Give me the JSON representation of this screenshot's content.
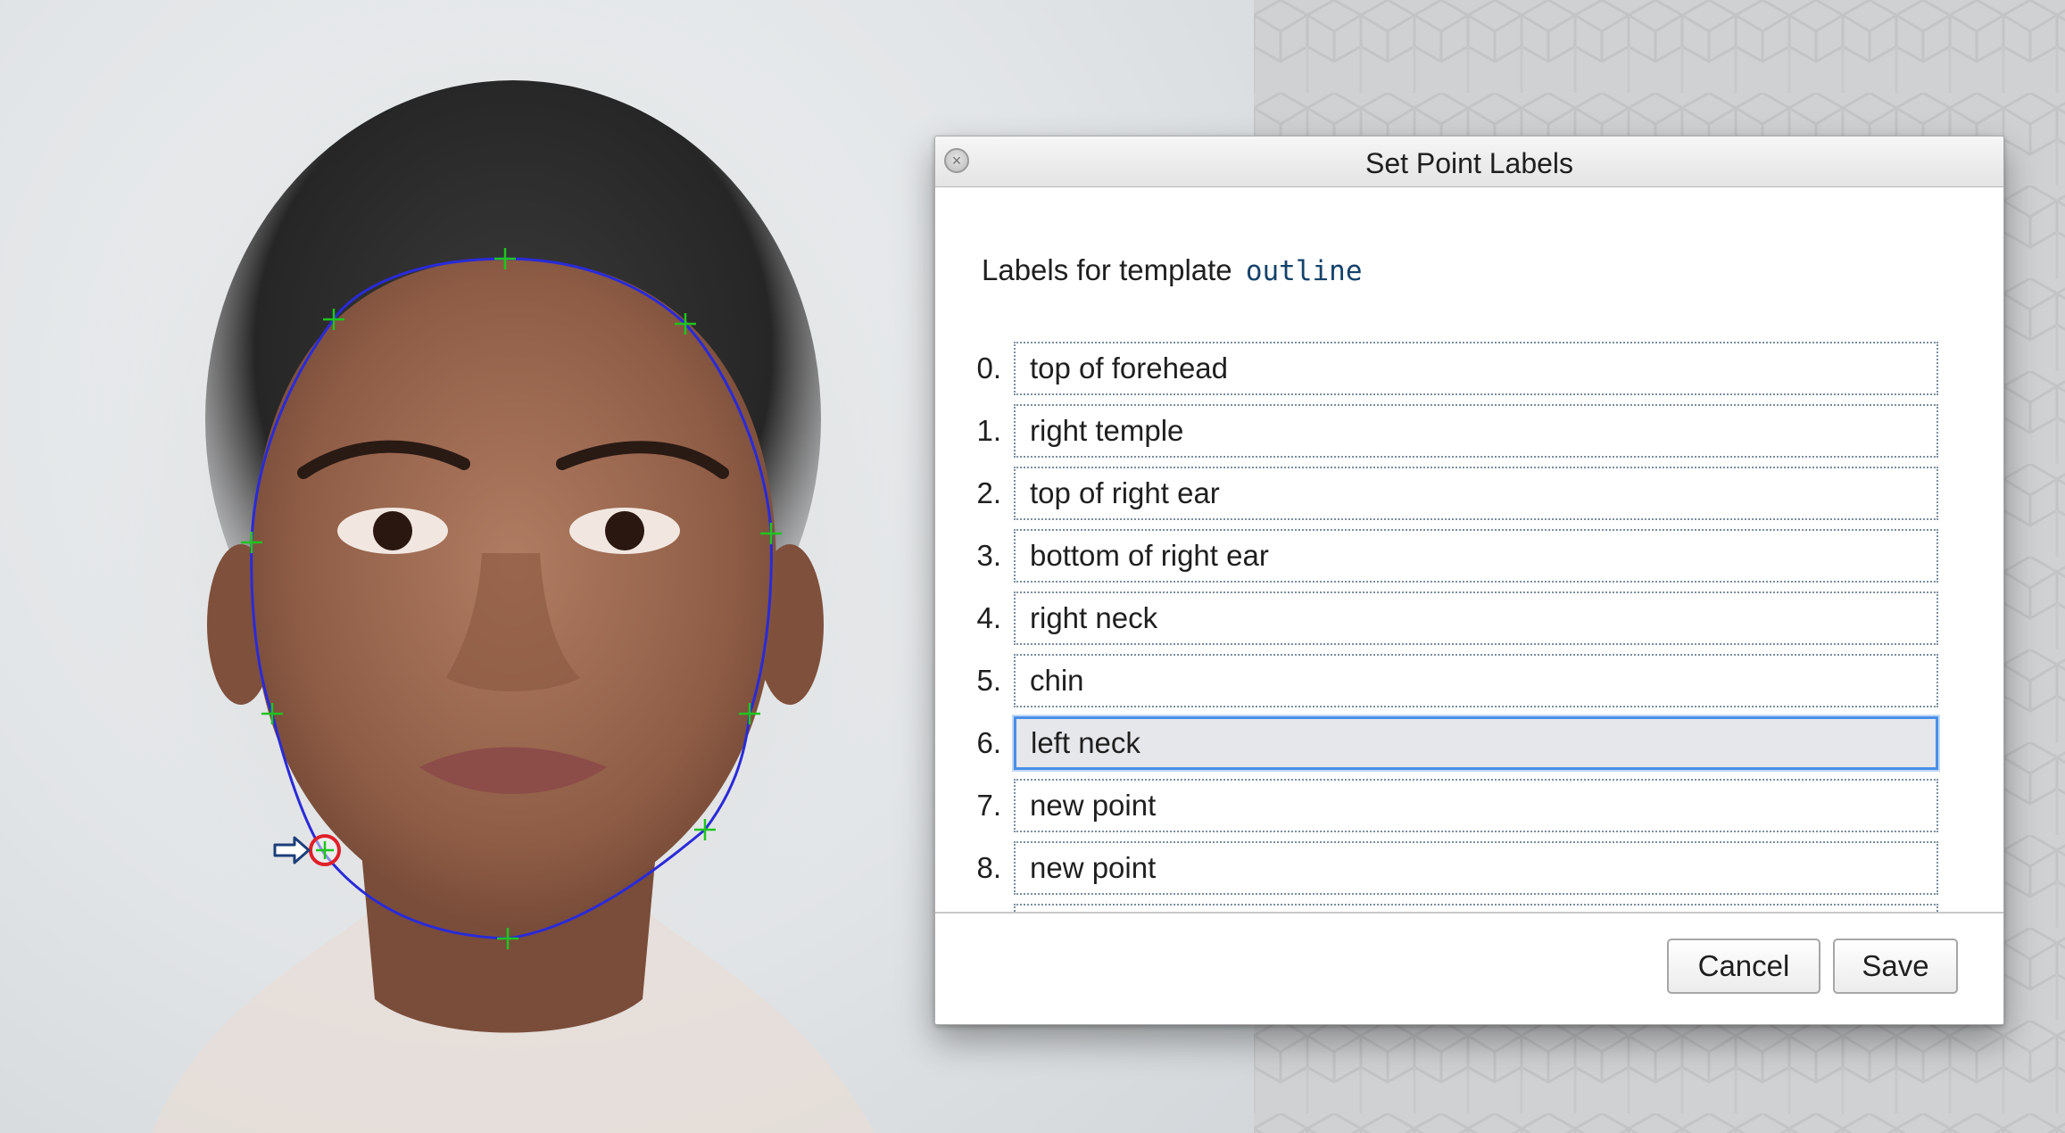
{
  "dialog": {
    "title": "Set Point Labels",
    "heading_prefix": "Labels for template",
    "template_name": "outline",
    "labels": [
      {
        "index": "0.",
        "value": "top of forehead"
      },
      {
        "index": "1.",
        "value": "right temple"
      },
      {
        "index": "2.",
        "value": "top of right ear"
      },
      {
        "index": "3.",
        "value": "bottom of right ear"
      },
      {
        "index": "4.",
        "value": "right neck"
      },
      {
        "index": "5.",
        "value": "chin"
      },
      {
        "index": "6.",
        "value": "left neck"
      },
      {
        "index": "7.",
        "value": "new point"
      },
      {
        "index": "8.",
        "value": "new point"
      }
    ],
    "focused_index": 6,
    "cancel_label": "Cancel",
    "save_label": "Save"
  },
  "colors": {
    "outline_curve": "#2a2ad8",
    "point_marker": "#1fc41f",
    "selected_point": "#e0202a",
    "focus_ring": "#4a8fe7"
  },
  "icons": {
    "close": "close-icon",
    "cursor": "arrow-cursor-icon"
  }
}
